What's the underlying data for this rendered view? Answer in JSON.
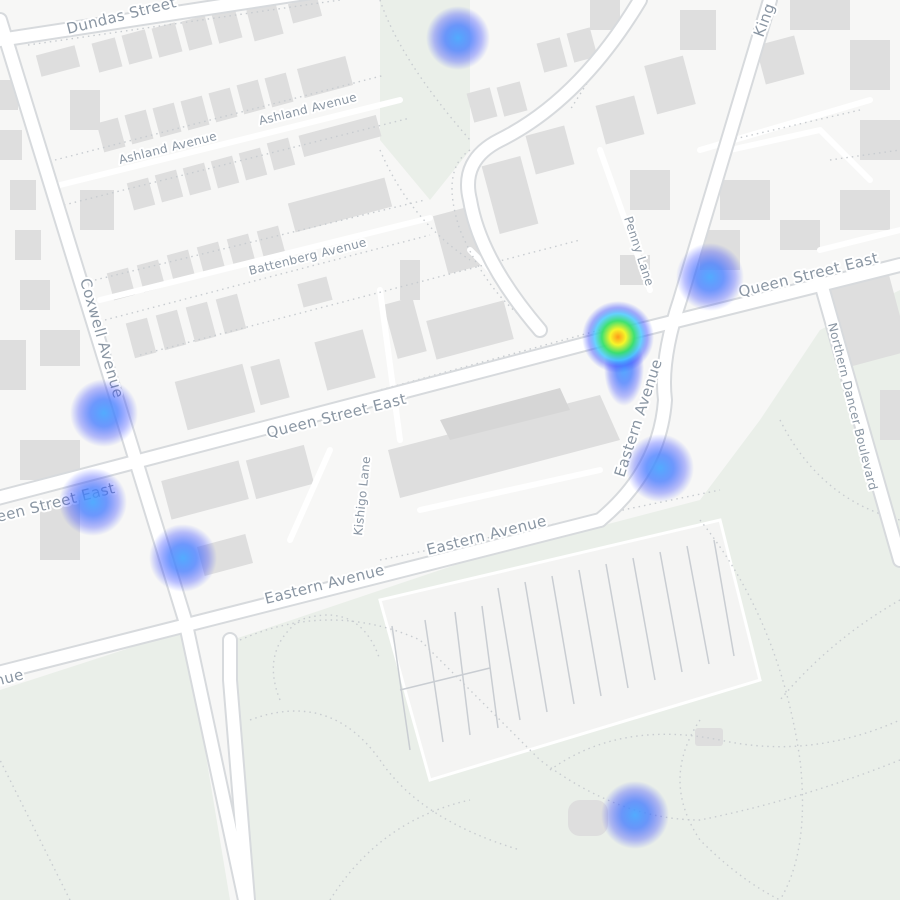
{
  "map": {
    "streets": {
      "dundas": "Dundas Street",
      "ashland_1": "Ashland Avenue",
      "ashland_2": "Ashland Avenue",
      "battenberg": "Battenberg Avenue",
      "coxwell": "Coxwell Avenue",
      "queen_main": "Queen Street East",
      "queen_left": "een Street East",
      "queen_right": "Queen Street East",
      "kishigo": "Kishigo Lane",
      "eastern_1": "Eastern Avenue",
      "eastern_2": "Eastern Avenue",
      "eastern_curve": "Eastern Avenue",
      "eastern_edge": "nue",
      "penny": "Penny Lane",
      "northern_dancer": "Northern Dancer Boulevard",
      "kingston": "King"
    },
    "heatmap": {
      "gradient": [
        "#3b4cff",
        "#40d8ff",
        "#36e06a",
        "#f6f52a",
        "#ff9a1a"
      ],
      "hotspots": [
        {
          "id": "queen-penny",
          "intensity": 1.0
        },
        {
          "id": "dundas-park",
          "intensity": 0.35
        },
        {
          "id": "queen-east",
          "intensity": 0.35
        },
        {
          "id": "coxwell-north",
          "intensity": 0.35
        },
        {
          "id": "coxwell-queen",
          "intensity": 0.35
        },
        {
          "id": "coxwell-eastern",
          "intensity": 0.35
        },
        {
          "id": "eastern-curve",
          "intensity": 0.4
        },
        {
          "id": "park-south",
          "intensity": 0.35
        }
      ]
    }
  }
}
